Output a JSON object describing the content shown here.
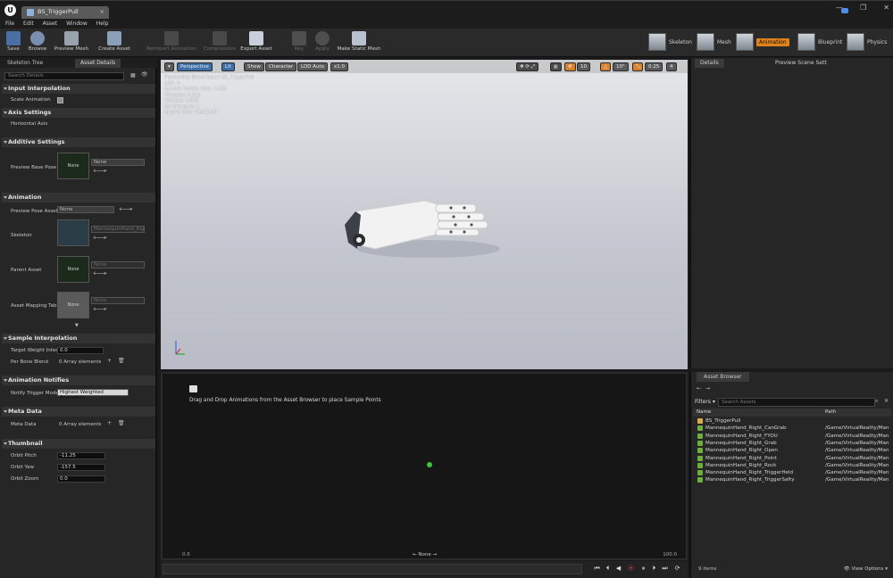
{
  "window": {
    "tab_title": "BS_TriggerPull",
    "controls": [
      "—",
      "❐",
      "✕"
    ]
  },
  "menu": [
    "File",
    "Edit",
    "Asset",
    "Window",
    "Help"
  ],
  "toolbar": {
    "save": "Save",
    "browse": "Browse",
    "preview_mesh": "Preview Mesh",
    "create_asset": "Create Asset",
    "reimport": "Reimport Animation",
    "compression": "Compression",
    "export": "Export Asset",
    "key": "Key",
    "apply": "Apply",
    "make_static": "Make Static Mesh"
  },
  "modes": {
    "skeleton": "Skeleton",
    "mesh": "Mesh",
    "animation": "Animation",
    "blueprint": "Blueprint",
    "physics": "Physics"
  },
  "left": {
    "tabs": [
      "Skeleton Tree",
      "Asset Details"
    ],
    "search_placeholder": "Search Details",
    "sections": {
      "input_interp": "Input Interpolation",
      "scale_anim": "Scale Animation",
      "axis_settings": "Axis Settings",
      "horizontal_axis": "Horizontal Axis",
      "additive": "Additive Settings",
      "preview_base_pose": "Preview Base Pose",
      "none": "None",
      "animation": "Animation",
      "preview_pose_asset": "Preview Pose Asset",
      "skeleton": "Skeleton",
      "skeleton_value": "MannequinHand_Right_Skeleton",
      "parent_asset": "Parent Asset",
      "asset_mapping": "Asset Mapping Tabl",
      "sample_interp": "Sample Interpolation",
      "target_weight": "Target Weight Interp",
      "target_weight_value": "0.0",
      "per_bone": "Per Bone Blend",
      "array_elements": "0 Array elements",
      "notifies": "Animation Notifies",
      "notify_mode": "Notify Trigger Mode",
      "notify_value": "Highest Weighted Animation",
      "meta": "Meta Data",
      "meta_data": "Meta Data",
      "thumbnail": "Thumbnail",
      "orbit_pitch": "Orbit Pitch",
      "orbit_pitch_v": "-11.25",
      "orbit_yaw": "Orbit Yaw",
      "orbit_yaw_v": "-157.5",
      "orbit_zoom": "Orbit Zoom",
      "orbit_zoom_v": "0.0"
    }
  },
  "viewport": {
    "perspective": "Perspective",
    "lit": "Lit",
    "show": "Show",
    "character": "Character",
    "lod": "LOD Auto",
    "speed": "x1.0",
    "snap_grid": "10",
    "snap_rot": "10°",
    "snap_scale": "0.25",
    "cam_speed": "4",
    "info": [
      "Previewing Blend Space BS_TriggerPull",
      "LOD: 0",
      "Current Screen Size: 1.058",
      "Triangles: 5,014",
      "Vertices: 3,025",
      "UV Channels: 1",
      "Approx Size: 14x12x41"
    ]
  },
  "blendspace": {
    "message": "Drag and Drop Animations from the Asset Browser to place Sample Points",
    "min": "0.0",
    "max": "100.0",
    "param": "None"
  },
  "right": {
    "tabs": [
      "Details",
      "Preview Scene Sett"
    ]
  },
  "asset_browser": {
    "tab": "Asset Browser",
    "filters": "Filters",
    "search_placeholder": "Search Assets",
    "col_name": "Name",
    "col_path": "Path",
    "rows": [
      {
        "name": "BS_TriggerPull",
        "path": "",
        "type": "blendspace"
      },
      {
        "name": "MannequinHand_Right_CanGrab",
        "path": "/Game/VirtualReality/Man",
        "type": "anim"
      },
      {
        "name": "MannequinHand_Right_FYOU",
        "path": "/Game/VirtualReality/Man",
        "type": "anim"
      },
      {
        "name": "MannequinHand_Right_Grab",
        "path": "/Game/VirtualReality/Man",
        "type": "anim"
      },
      {
        "name": "MannequinHand_Right_Open",
        "path": "/Game/VirtualReality/Man",
        "type": "anim"
      },
      {
        "name": "MannequinHand_Right_Point",
        "path": "/Game/VirtualReality/Man",
        "type": "anim"
      },
      {
        "name": "MannequinHand_Right_Rock",
        "path": "/Game/VirtualReality/Man",
        "type": "anim"
      },
      {
        "name": "MannequinHand_Right_TriggerHeld",
        "path": "/Game/VirtualReality/Man",
        "type": "anim"
      },
      {
        "name": "MannequinHand_Right_TriggerSafty",
        "path": "/Game/VirtualReality/Man",
        "type": "anim"
      }
    ],
    "count": "9 items",
    "view_options": "View Options"
  }
}
